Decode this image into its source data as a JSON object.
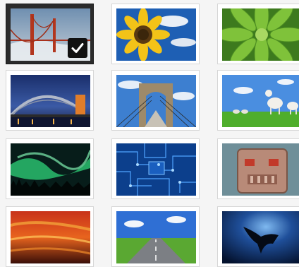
{
  "gallery": {
    "selected_index": 0,
    "items": [
      {
        "subject": "golden-gate-bridge",
        "selected": true
      },
      {
        "subject": "sunflower",
        "selected": false
      },
      {
        "subject": "green-succulent",
        "selected": false
      },
      {
        "subject": "harbour-bridge-night",
        "selected": false
      },
      {
        "subject": "brooklyn-bridge",
        "selected": false
      },
      {
        "subject": "lambs-on-grass",
        "selected": false
      },
      {
        "subject": "aurora",
        "selected": false
      },
      {
        "subject": "circuit-board",
        "selected": false
      },
      {
        "subject": "robot",
        "selected": false
      },
      {
        "subject": "sunset-sky",
        "selected": false
      },
      {
        "subject": "road",
        "selected": false
      },
      {
        "subject": "manta-ray",
        "selected": false
      }
    ]
  },
  "icons": {
    "checkmark": "check-icon"
  },
  "colors": {
    "page_background": "#f5f5f5",
    "selected_frame": "#2b2b2b",
    "frame_border": "#d6d6d6"
  }
}
